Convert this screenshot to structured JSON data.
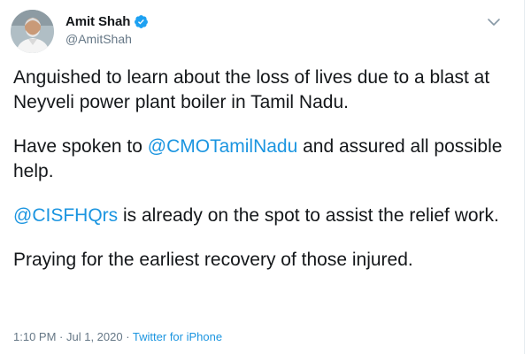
{
  "tweet": {
    "author": {
      "display_name": "Amit Shah",
      "handle": "@AmitShah",
      "verified": true
    },
    "body": {
      "p1": "Anguished to learn about the loss of lives due to a blast at Neyveli power plant boiler in Tamil Nadu.",
      "p2_before": "Have spoken to ",
      "p2_mention": "@CMOTamilNadu",
      "p2_after": " and assured all possible help.",
      "p3_mention": "@CISFHQrs",
      "p3_after": " is already on the spot to assist the relief work.",
      "p4": "Praying for the earliest recovery of those injured."
    },
    "meta": {
      "time": "1:10 PM",
      "separator1": " · ",
      "date": "Jul 1, 2020",
      "separator2": " · ",
      "source": "Twitter for iPhone"
    }
  },
  "colors": {
    "text": "#14171a",
    "secondary": "#657786",
    "link": "#1b95e0",
    "verified": "#1da1f2"
  },
  "icons": {
    "verified": "verified-badge-icon",
    "caret": "chevron-down-icon",
    "avatar": "profile-photo"
  }
}
